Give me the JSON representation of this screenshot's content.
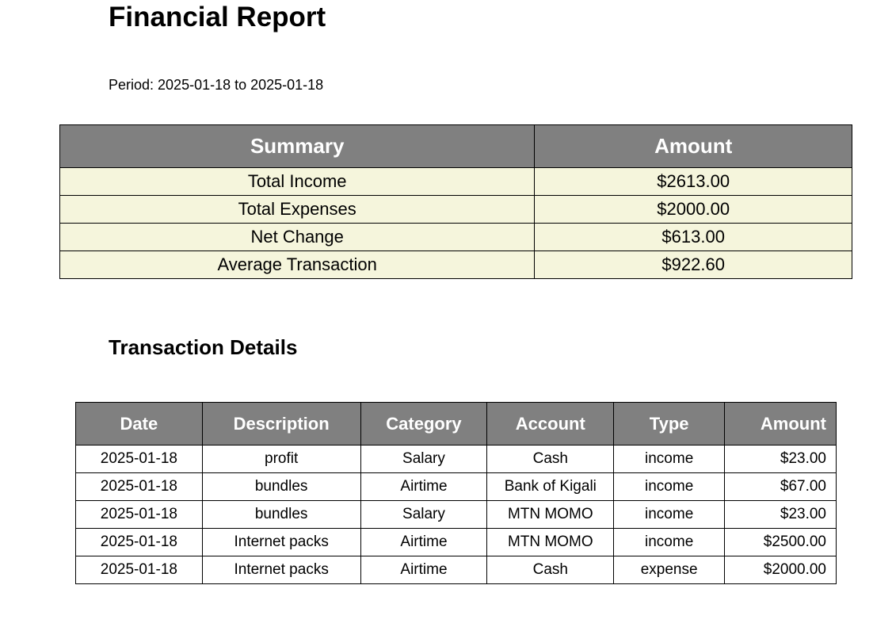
{
  "title": "Financial Report",
  "period": "Period: 2025-01-18 to 2025-01-18",
  "summary": {
    "headers": [
      "Summary",
      "Amount"
    ],
    "rows": [
      [
        "Total Income",
        "$2613.00"
      ],
      [
        "Total Expenses",
        "$2000.00"
      ],
      [
        "Net Change",
        "$613.00"
      ],
      [
        "Average Transaction",
        "$922.60"
      ]
    ]
  },
  "details_title": "Transaction Details",
  "details": {
    "headers": [
      "Date",
      "Description",
      "Category",
      "Account",
      "Type",
      "Amount"
    ],
    "rows": [
      [
        "2025-01-18",
        "profit",
        "Salary",
        "Cash",
        "income",
        "$23.00"
      ],
      [
        "2025-01-18",
        "bundles",
        "Airtime",
        "Bank of Kigali",
        "income",
        "$67.00"
      ],
      [
        "2025-01-18",
        "bundles",
        "Salary",
        "MTN MOMO",
        "income",
        "$23.00"
      ],
      [
        "2025-01-18",
        "Internet packs",
        "Airtime",
        "MTN MOMO",
        "income",
        "$2500.00"
      ],
      [
        "2025-01-18",
        "Internet packs",
        "Airtime",
        "Cash",
        "expense",
        "$2000.00"
      ]
    ]
  },
  "colors": {
    "header_bg": "#808080",
    "summary_row_bg": "#f5f5dc"
  }
}
